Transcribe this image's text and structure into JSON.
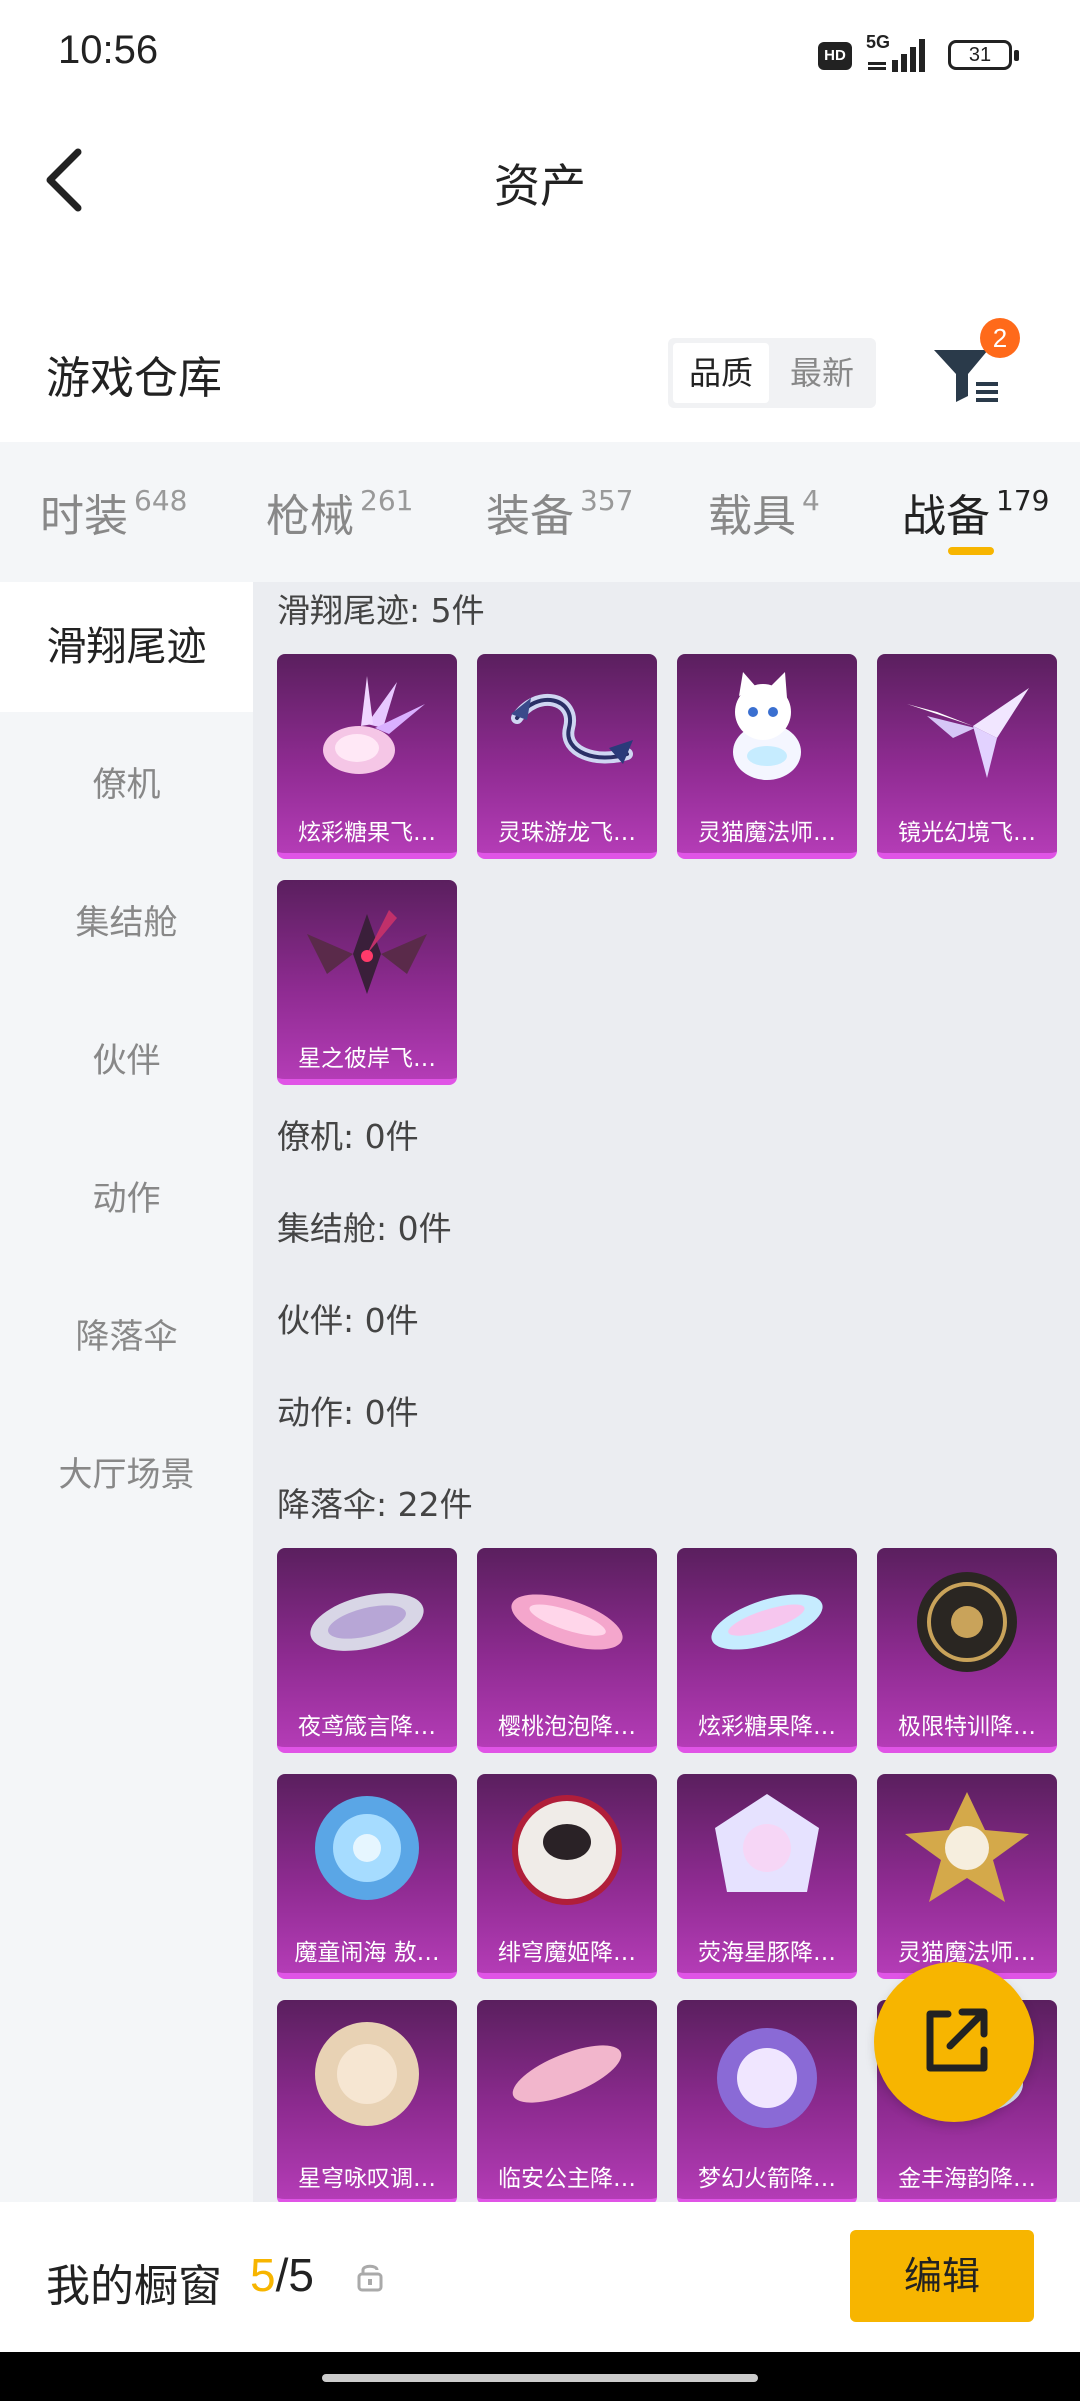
{
  "status": {
    "time": "10:56",
    "hd": "HD",
    "network": "5G",
    "battery": "31"
  },
  "nav": {
    "title": "资产",
    "back_icon": "chevron-left-icon"
  },
  "warehouse": {
    "title": "游戏仓库",
    "sort_options": [
      "品质",
      "最新"
    ],
    "sort_selected": "品质",
    "filter_badge": "2",
    "filter_icon": "funnel-filter-icon"
  },
  "tabs": [
    {
      "label": "时装",
      "count": "648"
    },
    {
      "label": "枪械",
      "count": "261"
    },
    {
      "label": "装备",
      "count": "357"
    },
    {
      "label": "载具",
      "count": "4"
    },
    {
      "label": "战备",
      "count": "179"
    }
  ],
  "active_tab": "战备",
  "sidebar": [
    "滑翔尾迹",
    "僚机",
    "集结舱",
    "伙伴",
    "动作",
    "降落伞",
    "大厅场景"
  ],
  "groups": {
    "glide": {
      "label": "滑翔尾迹: 5件",
      "items": [
        "炫彩糖果飞…",
        "灵珠游龙飞…",
        "灵猫魔法师…",
        "镜光幻境飞…",
        "星之彼岸飞…"
      ]
    },
    "wingman": {
      "label": "僚机: 0件"
    },
    "pod": {
      "label": "集结舱: 0件"
    },
    "partner": {
      "label": "伙伴: 0件"
    },
    "emote": {
      "label": "动作: 0件"
    },
    "parachute": {
      "label": "降落伞: 22件",
      "items": [
        "夜鸢箴言降…",
        "樱桃泡泡降…",
        "炫彩糖果降…",
        "极限特训降…",
        "魔童闹海 敖…",
        "绯穹魔姬降…",
        "荧海星豚降…",
        "灵猫魔法师…",
        "星穹咏叹调…",
        "临安公主降…",
        "梦幻火箭降…",
        "金丰海韵降…"
      ]
    }
  },
  "bottom": {
    "showcase_label": "我的橱窗",
    "showcase_current": "5",
    "showcase_sep": "/",
    "showcase_total": "5",
    "edit_label": "编辑"
  },
  "colors": {
    "accent": "#f7b500",
    "card_top": "#5a1f5e",
    "card_bottom": "#b43cb6",
    "badge": "#ff6a1a"
  }
}
